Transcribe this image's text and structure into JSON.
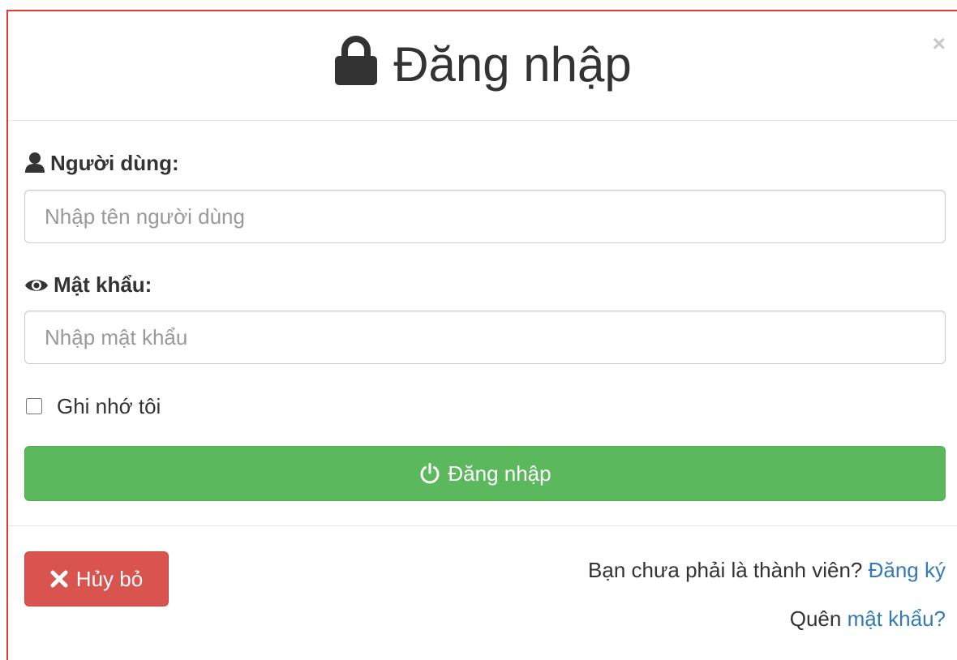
{
  "modal": {
    "title": "Đăng nhập",
    "close_symbol": "×",
    "icons": {
      "title": "lock-icon",
      "username": "user-icon",
      "password": "eye-icon",
      "submit": "power-icon",
      "cancel": "times-icon"
    }
  },
  "form": {
    "username_label": "Người dùng:",
    "username_placeholder": "Nhập tên người dùng",
    "username_value": "",
    "password_label": "Mật khẩu:",
    "password_placeholder": "Nhập mật khẩu",
    "password_value": "",
    "remember_label": "Ghi nhớ tôi",
    "remember_checked": false,
    "submit_label": "Đăng nhập"
  },
  "footer": {
    "cancel_label": "Hủy bỏ",
    "not_member_text": "Bạn chưa phải là thành viên?",
    "register_link": "Đăng ký",
    "forgot_text": "Quên",
    "forgot_link": "mật khẩu?"
  },
  "colors": {
    "success": "#5cb85c",
    "danger": "#d9534f",
    "link": "#337ab7",
    "frame_border": "#e53935"
  }
}
